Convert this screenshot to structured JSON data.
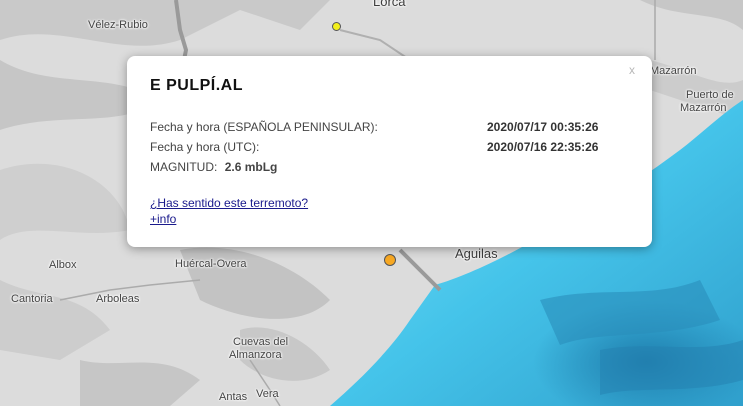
{
  "map": {
    "places": [
      {
        "id": "velez-rubio",
        "name": "Vélez-Rubio",
        "size": "normal"
      },
      {
        "id": "lorca",
        "name": "Lorca",
        "size": "big"
      },
      {
        "id": "mazarron",
        "name": "Mazarrón",
        "size": "normal"
      },
      {
        "id": "puerto-1",
        "name": "Puerto de",
        "size": "normal"
      },
      {
        "id": "puerto-2",
        "name": "Mazarrón",
        "size": "normal"
      },
      {
        "id": "albox",
        "name": "Albox",
        "size": "normal"
      },
      {
        "id": "huercal-overa",
        "name": "Huércal-Overa",
        "size": "normal"
      },
      {
        "id": "aguilas",
        "name": "Aguilas",
        "size": "big"
      },
      {
        "id": "cantoria",
        "name": "Cantoria",
        "size": "normal"
      },
      {
        "id": "arboleas",
        "name": "Arboleas",
        "size": "normal"
      },
      {
        "id": "cuevas-1",
        "name": "Cuevas del",
        "size": "normal"
      },
      {
        "id": "cuevas-2",
        "name": "Almanzora",
        "size": "normal"
      },
      {
        "id": "antas",
        "name": "Antas",
        "size": "normal"
      },
      {
        "id": "vera",
        "name": "Vera",
        "size": "normal"
      }
    ],
    "markers": [
      {
        "id": "yellow-quake",
        "color": "#f3f01c"
      },
      {
        "id": "orange-quake",
        "color": "#f7a823"
      }
    ],
    "colors": {
      "land": "#d9d9d9",
      "sea_shallow": "#63d6f0",
      "sea_deep": "#2a8fbd",
      "road": "#9a9a9a"
    }
  },
  "popup": {
    "close": "x",
    "title": "E PULPÍ.AL",
    "rows": [
      {
        "label": "Fecha y hora (ESPAÑOLA PENINSULAR):",
        "value": "2020/07/17 00:35:26"
      },
      {
        "label": "Fecha y hora (UTC):",
        "value": "2020/07/16 22:35:26"
      }
    ],
    "magnitude_label": "MAGNITUD:",
    "magnitude_value": "2.6 mbLg",
    "link_felt": "¿Has sentido este terremoto?",
    "link_info": "+info"
  }
}
